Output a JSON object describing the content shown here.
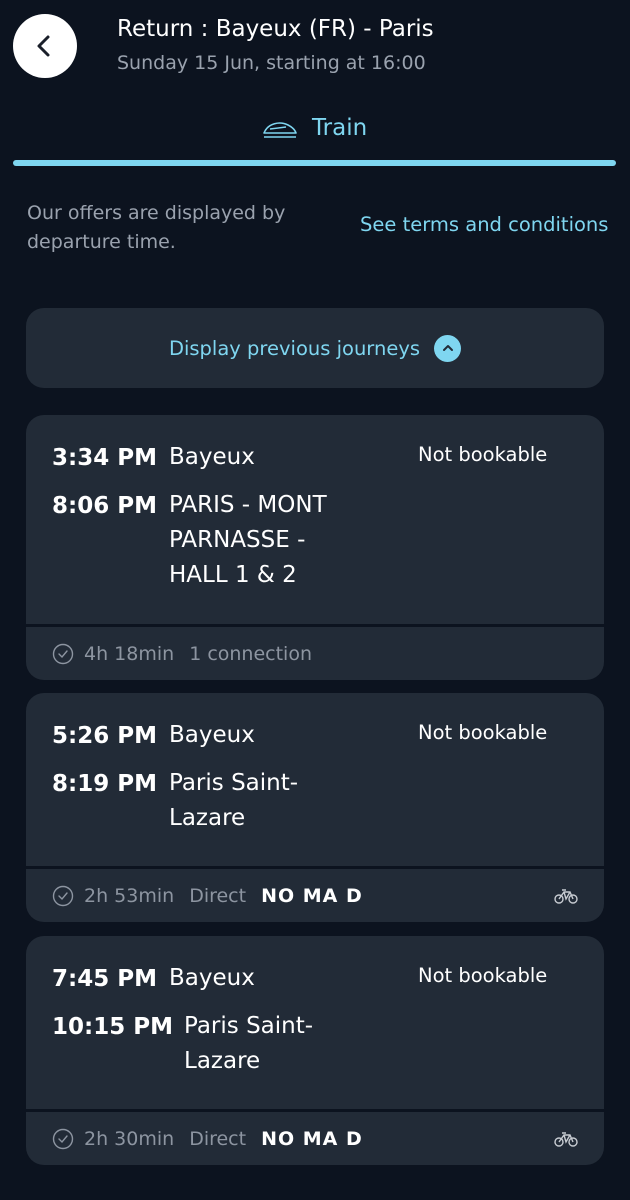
{
  "header": {
    "title": "Return : Bayeux (FR) - Paris",
    "subtitle": "Sunday 15 Jun, starting at 16:00"
  },
  "tab": {
    "label": "Train",
    "icon": "train-icon"
  },
  "info": {
    "text": "Our offers are displayed by departure time.",
    "terms_link": "See terms and conditions"
  },
  "previous_button": {
    "label": "Display previous journeys"
  },
  "journeys": [
    {
      "dep_time": "3:34 PM",
      "dep_station": "Bayeux",
      "arr_time": "8:06 PM",
      "arr_station": "PARIS - MONT PARNASSE - HALL 1 & 2",
      "status": "Not bookable",
      "duration": "4h 18min",
      "connections": "1 connection"
    },
    {
      "dep_time": "5:26 PM",
      "dep_station": "Bayeux",
      "arr_time": "8:19 PM",
      "arr_station": "Paris Saint-Lazare",
      "status": "Not bookable",
      "duration": "2h 53min",
      "connections": "Direct",
      "operator": "NO MA D"
    },
    {
      "dep_time": "7:45 PM",
      "dep_station": "Bayeux",
      "arr_time": "10:15 PM",
      "arr_station": "Paris Saint-Lazare",
      "status": "Not bookable",
      "duration": "2h 30min",
      "connections": "Direct",
      "operator": "NO MA D"
    }
  ],
  "colors": {
    "background": "#0c131f",
    "card": "#222b37",
    "accent": "#7fd6f0",
    "muted": "#9aa2ae"
  }
}
